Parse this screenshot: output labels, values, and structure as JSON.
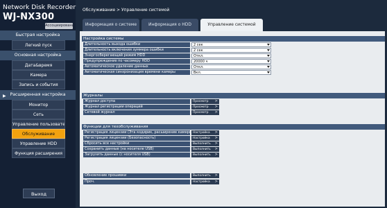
{
  "app": {
    "brand": "Network Disk Recorder",
    "model": "WJ-NX300",
    "user_badge": "Ассоциирование"
  },
  "sidebar": {
    "quick_setup": "Быстрая настройка",
    "easy_start": "Легкий пуск",
    "basic_setup": "Основная настройка",
    "basic_items": [
      "Дата&время",
      "Камера",
      "Запись и события"
    ],
    "advanced_setup": "Расширенная настройка",
    "advanced_items": [
      "Монитор",
      "Сеть",
      "Управление пользователем",
      "Обслуживание",
      "Управление HDD",
      "Функция расширения"
    ],
    "exit": "Выход"
  },
  "breadcrumb": "Обслуживание > Управление системой",
  "tabs": [
    "Информация о системе",
    "Информация о HDD",
    "Управление системой"
  ],
  "system_settings": {
    "title": "Настройка системы",
    "rows": [
      {
        "label": "Длительность выхода ошибки",
        "value": "2 сек"
      },
      {
        "label": "Длительность включения зуммера ошибки",
        "value": "2 сек"
      },
      {
        "label": "Энергосберегающий режим HDD",
        "value": "Откл."
      },
      {
        "label": "Предупреждение по часомеру HDD",
        "value": "20000 ч"
      },
      {
        "label": "Автоматическое удаление данных",
        "value": "Откл."
      },
      {
        "label": "Автоматическая синхронизация времени камеры",
        "value": "Вкл."
      }
    ]
  },
  "logs": {
    "title": "Журналы",
    "rows": [
      {
        "label": "Журнал доступа",
        "button": "Просмотр"
      },
      {
        "label": "Журнал регистрации операций",
        "button": "Просмотр"
      },
      {
        "label": "Сетевой журнал",
        "button": "Просмотр"
      }
    ]
  },
  "maintenance": {
    "title": "Функции для техобслуживания",
    "rows": [
      {
        "label": "Регистрация лицензии (Эта кодирик, расширение камеры и пр.)",
        "button": "Настройка"
      },
      {
        "label": "Регистрация лицензии (Безопасность)",
        "button": "Настройка"
      },
      {
        "label": "Сбросить все настройки",
        "button": "Выполнить"
      },
      {
        "label": "Сохранить данные (на носителе USB)",
        "button": "Выполнить"
      },
      {
        "label": "Загрузить данные (с носителя USB)",
        "button": "Выполнить"
      }
    ],
    "extra_rows": [
      {
        "label": "Обновление прошивки",
        "button": "Выполнить"
      },
      {
        "label": "Проч.",
        "button": "Настройка"
      }
    ]
  },
  "icons": {
    "button_chevron": ">",
    "dropdown": "triangle-down"
  }
}
